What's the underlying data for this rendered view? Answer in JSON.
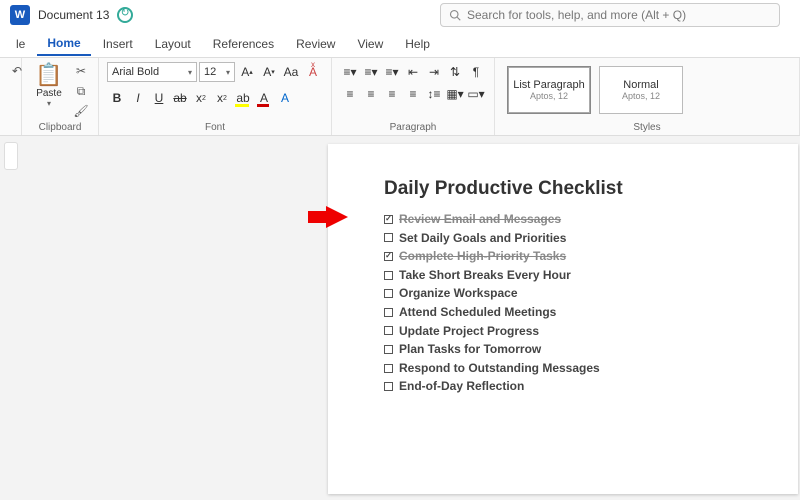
{
  "titlebar": {
    "doc_name": "Document 13"
  },
  "search": {
    "placeholder": "Search for tools, help, and more (Alt + Q)"
  },
  "tabs": {
    "file": "le",
    "home": "Home",
    "insert": "Insert",
    "layout": "Layout",
    "references": "References",
    "review": "Review",
    "view": "View",
    "help": "Help"
  },
  "ribbon": {
    "clipboard": {
      "paste": "Paste",
      "label": "Clipboard"
    },
    "font": {
      "name": "Arial Bold",
      "size": "12",
      "label": "Font"
    },
    "paragraph": {
      "label": "Paragraph"
    },
    "styles": {
      "label": "Styles",
      "items": [
        {
          "name": "List Paragraph",
          "sub": "Aptos, 12",
          "active": true
        },
        {
          "name": "Normal",
          "sub": "Aptos, 12",
          "active": false
        }
      ]
    }
  },
  "document": {
    "title": "Daily Productive Checklist",
    "items": [
      {
        "text": "Review Email and Messages",
        "checked": true,
        "strike": true
      },
      {
        "text": "Set Daily Goals and Priorities",
        "checked": false,
        "strike": false
      },
      {
        "text": "Complete High-Priority Tasks",
        "checked": true,
        "strike": true
      },
      {
        "text": "Take Short Breaks Every Hour",
        "checked": false,
        "strike": false
      },
      {
        "text": "Organize Workspace",
        "checked": false,
        "strike": false
      },
      {
        "text": " Attend Scheduled Meetings",
        "checked": false,
        "strike": false
      },
      {
        "text": "Update Project Progress",
        "checked": false,
        "strike": false
      },
      {
        "text": " Plan Tasks for Tomorrow",
        "checked": false,
        "strike": false
      },
      {
        "text": "Respond to Outstanding Messages",
        "checked": false,
        "strike": false
      },
      {
        "text": "End-of-Day Reflection",
        "checked": false,
        "strike": false
      }
    ]
  }
}
